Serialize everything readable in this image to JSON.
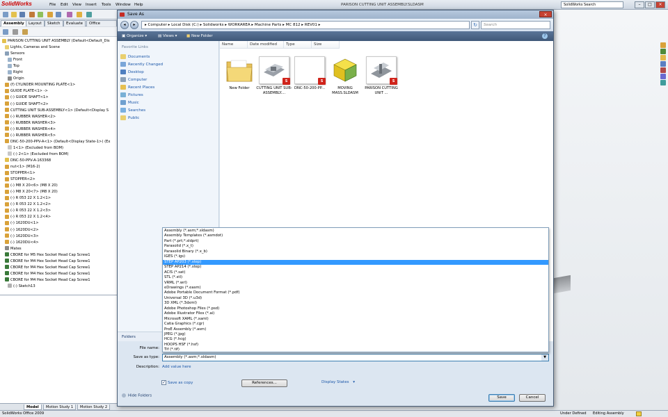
{
  "app": {
    "logo": "SolidWorks",
    "menus": [
      "File",
      "Edit",
      "View",
      "Insert",
      "Tools",
      "Window",
      "Help"
    ],
    "document_title": "PARISON CUTTING UNIT ASSEMBLY.SLDASM",
    "search_placeholder": "SolidWorks Search",
    "command_tabs": [
      "Assembly",
      "Layout",
      "Sketch",
      "Evaluate",
      "Office Products"
    ],
    "bottom_tabs": [
      "Model",
      "Motion Study 1",
      "Motion Study 2"
    ],
    "status": {
      "version": "SolidWorks Office 2009",
      "state": "Under Defined",
      "mode": "Editing Assembly"
    }
  },
  "tree": {
    "items": [
      "PARISON CUTTING UNIT ASSEMBLY  (Default<Default_Dis",
      "Lights, Cameras and Scene",
      "Sensors",
      "Front",
      "Top",
      "Right",
      "Origin",
      "(f) CYLINDER MOUNTING PLATE<1>",
      "GUIDE PLATE<1> ->",
      "(-) GUIDE SHAFT<1>",
      "(-) GUIDE SHAFT<2>",
      "CUTTING UNIT SUB-ASSEMBLY<1> (Default<Display S",
      "(-) RUBBER WASHER<2>",
      "(-) RUBBER WASHER<3>",
      "(-) RUBBER WASHER<4>",
      "(-) RUBBER WASHER<5>",
      "DNC-50-200-PPV-A<1> (Default<Display State-1>) (Ex",
      "1<1> (Excluded from BOM)",
      "(-) 2<1> (Excluded from BOM)",
      "DNC-50-PPV-A-163368",
      "nut<1> (M16-2)",
      "STOPPER<1>",
      "STOPPER<2>",
      "(-) M8 X 20<6> (M8 X 20)",
      "(-) M8 X 20<7> (M8 X 20)",
      "(-) R 053 22 X 1.2<1>",
      "(-) R 053 22 X 1.2<2>",
      "(-) R 053 22 X 1.2<3>",
      "(-) R 053 22 X 1.2<4>",
      "(-) 1620DU<1>",
      "(-) 1620DU<2>",
      "(-) 1620DU<3>",
      "(-) 1620DU<4>",
      "Mates",
      "CBORE for M5 Hex Socket Head Cap Screw1",
      "CBORE for M4 Hex Socket Head Cap Screw1",
      "CBORE for M4 Hex Socket Head Cap Screw1",
      "CBORE for M4 Hex Socket Head Cap Screw1",
      "CBORE for M4 Hex Socket Head Cap Screw1",
      "(-) Sketch13"
    ]
  },
  "dialog": {
    "title": "Save As",
    "address": "▸  Computer  ▸  Local Disk (C:)  ▸  Solidworks  ▸  WORKAREA  ▸  Machine Parts  ▸  MC 812  ▸  REV01  ▸",
    "search_placeholder": "Search",
    "toolbar": {
      "organize": "Organize",
      "views": "Views",
      "new_folder": "New Folder"
    },
    "favorites_heading": "Favorite Links",
    "favorites": [
      "Documents",
      "Recently Changed",
      "Desktop",
      "Computer",
      "Recent Places",
      "Pictures",
      "Music",
      "Searches",
      "Public"
    ],
    "folders_label": "Folders",
    "columns": [
      "Name",
      "Date modified",
      "Type",
      "Size"
    ],
    "files": [
      {
        "name": "New Folder",
        "kind": "folder"
      },
      {
        "name": "CUTTING UNIT SUB-ASSEMBLY....",
        "kind": "assembly"
      },
      {
        "name": "DNC-50-200-PP...",
        "kind": "blank"
      },
      {
        "name": "MOVING MASS.SLDASM",
        "kind": "cube"
      },
      {
        "name": "PARISON CUTTING UNIT ...",
        "kind": "assembly"
      }
    ],
    "file_types": [
      "Assembly (*.asm;*.sldasm)",
      "Assembly Templates (*.asmdot)",
      "Part (*.prt;*.sldprt)",
      "Parasolid (*.x_t)",
      "Parasolid Binary (*.x_b)",
      "IGES (*.igs)",
      "STEP AP203 (*.step)",
      "STEP AP214 (*.step)",
      "ACIS (*.sat)",
      "STL (*.stl)",
      "VRML (*.wrl)",
      "eDrawings (*.easm)",
      "Adobe Portable Document Format (*.pdf)",
      "Universal 3D (*.u3d)",
      "3D XML (*.3dxml)",
      "Adobe Photoshop Files  (*.psd)",
      "Adobe Illustrator Files (*.ai)",
      "Microsoft XAML (*.xaml)",
      "Catia Graphics (*.cgr)",
      "ProE Assembly (*.asm)",
      "JPEG (*.jpg)",
      "HCG (*.hcg)",
      "HOOPS HSF (*.hsf)",
      "Tif (*.tif)"
    ],
    "selected_type_index": 6,
    "labels": {
      "file_name": "File name:",
      "save_as_type": "Save as type:",
      "description": "Description:"
    },
    "save_as_type_value": "Assembly (*.asm;*.sldasm)",
    "add_value_here": "Add value here",
    "save_as_copy": "Save as copy",
    "references": "References...",
    "display_states": "Display States",
    "hide_folders": "Hide Folders",
    "save": "Save",
    "cancel": "Cancel"
  }
}
